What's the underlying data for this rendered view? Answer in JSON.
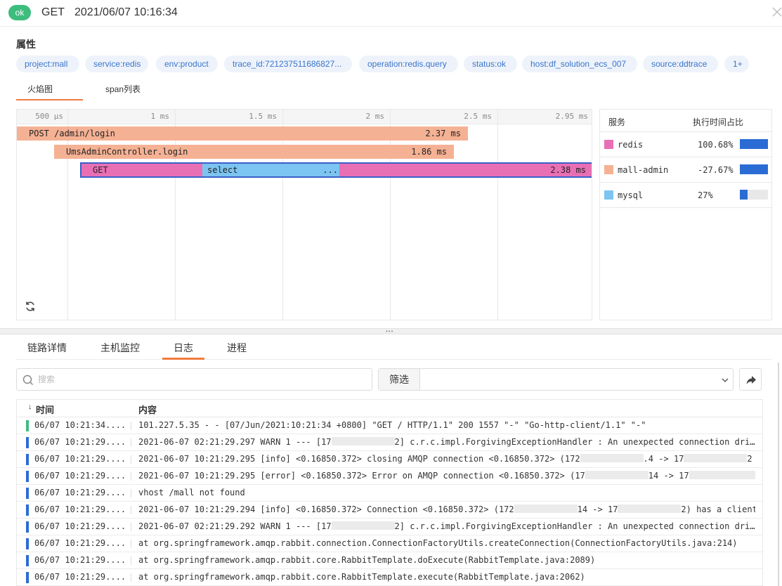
{
  "header": {
    "status": "ok",
    "method": "GET",
    "datetime": "2021/06/07 10:16:34"
  },
  "attributes": {
    "title": "属性",
    "tags": [
      "project:mall",
      "service:redis",
      "env:product",
      "trace_id:721237511686827...",
      "operation:redis.query",
      "status:ok",
      "host:df_solution_ecs_007",
      "source:ddtrace",
      "1+"
    ]
  },
  "view_tabs": [
    "火焰图",
    "span列表"
  ],
  "flame": {
    "ticks": [
      "500 µs",
      "1 ms",
      "1.5 ms",
      "2 ms",
      "2.5 ms",
      "2.95 ms"
    ],
    "spans": [
      {
        "name": "POST /admin/login",
        "duration": "2.37 ms",
        "service": "mall-admin"
      },
      {
        "name": "UmsAdminController.login",
        "duration": "1.86 ms",
        "service": "mall-admin"
      },
      {
        "name": "GET",
        "duration": "2.38 ms",
        "service": "redis"
      },
      {
        "name": "select",
        "suffix": "...",
        "service": "mysql"
      }
    ]
  },
  "services": {
    "headers": [
      "服务",
      "执行时间占比"
    ],
    "rows": [
      {
        "name": "redis",
        "pct": "100.68%",
        "fraction": 1.0,
        "color": "#e96fb5"
      },
      {
        "name": "mall-admin",
        "pct": "-27.67%",
        "fraction": 1.0,
        "color": "#f5b194"
      },
      {
        "name": "mysql",
        "pct": "27%",
        "fraction": 0.27,
        "color": "#7cc4f1"
      }
    ]
  },
  "detail_tabs": [
    "链路详情",
    "主机监控",
    "日志",
    "进程"
  ],
  "active_detail_tab": "日志",
  "search": {
    "placeholder": "搜索",
    "value": ""
  },
  "filter": {
    "label": "筛选",
    "value": ""
  },
  "logs": {
    "columns": [
      "时间",
      "内容"
    ],
    "rows": [
      {
        "time": "06/07 10:21:34....",
        "level_color": "#3dbd7d",
        "content": [
          {
            "t": "101.227.5.35 - - [07/Jun/2021:10:21:34 +0800] \"GET / HTTP/1.1\" 200 1557 \"-\" \"Go-http-client/1.1\" \"-\""
          }
        ]
      },
      {
        "time": "06/07 10:21:29....",
        "level_color": "#2b6cd4",
        "content": [
          {
            "t": "2021-06-07 02:21:29.297 WARN 1 --- [17"
          },
          {
            "m": 90
          },
          {
            "t": "2] c.r.c.impl.ForgivingExceptionHandler : An unexpected connection dri…"
          }
        ]
      },
      {
        "time": "06/07 10:21:29....",
        "level_color": "#2b6cd4",
        "content": [
          {
            "t": "2021-06-07 10:21:29.295 [info] <0.16850.372> closing AMQP connection <0.16850.372> (172"
          },
          {
            "m": 90
          },
          {
            "t": ".4 -> 17"
          },
          {
            "m": 90
          },
          {
            "t": "2 …"
          }
        ]
      },
      {
        "time": "06/07 10:21:29....",
        "level_color": "#2b6cd4",
        "content": [
          {
            "t": "2021-06-07 10:21:29.295 [error] <0.16850.372> Error on AMQP connection <0.16850.372> (17"
          },
          {
            "m": 90
          },
          {
            "t": "14 -> 17"
          },
          {
            "m": 100
          },
          {
            "t": "…"
          }
        ]
      },
      {
        "time": "06/07 10:21:29....",
        "level_color": "#2b6cd4",
        "content": [
          {
            "t": "vhost /mall not found"
          }
        ]
      },
      {
        "time": "06/07 10:21:29....",
        "level_color": "#2b6cd4",
        "content": [
          {
            "t": "2021-06-07 10:21:29.294 [info] <0.16850.372> Connection <0.16850.372> (172"
          },
          {
            "m": 90
          },
          {
            "t": "14 -> 17"
          },
          {
            "m": 90
          },
          {
            "t": "2) has a client…"
          }
        ]
      },
      {
        "time": "06/07 10:21:29....",
        "level_color": "#2b6cd4",
        "content": [
          {
            "t": "2021-06-07 02:21:29.292 WARN 1 --- [17"
          },
          {
            "m": 90
          },
          {
            "t": "2] c.r.c.impl.ForgivingExceptionHandler : An unexpected connection dri…"
          }
        ]
      },
      {
        "time": "06/07 10:21:29....",
        "level_color": "#2b6cd4",
        "content": [
          {
            "t": "at org.springframework.amqp.rabbit.connection.ConnectionFactoryUtils.createConnection(ConnectionFactoryUtils.java:214)"
          }
        ]
      },
      {
        "time": "06/07 10:21:29....",
        "level_color": "#2b6cd4",
        "content": [
          {
            "t": "at org.springframework.amqp.rabbit.core.RabbitTemplate.doExecute(RabbitTemplate.java:2089)"
          }
        ]
      },
      {
        "time": "06/07 10:21:29....",
        "level_color": "#2b6cd4",
        "content": [
          {
            "t": "at org.springframework.amqp.rabbit.core.RabbitTemplate.execute(RabbitTemplate.java:2062)"
          }
        ]
      }
    ]
  }
}
